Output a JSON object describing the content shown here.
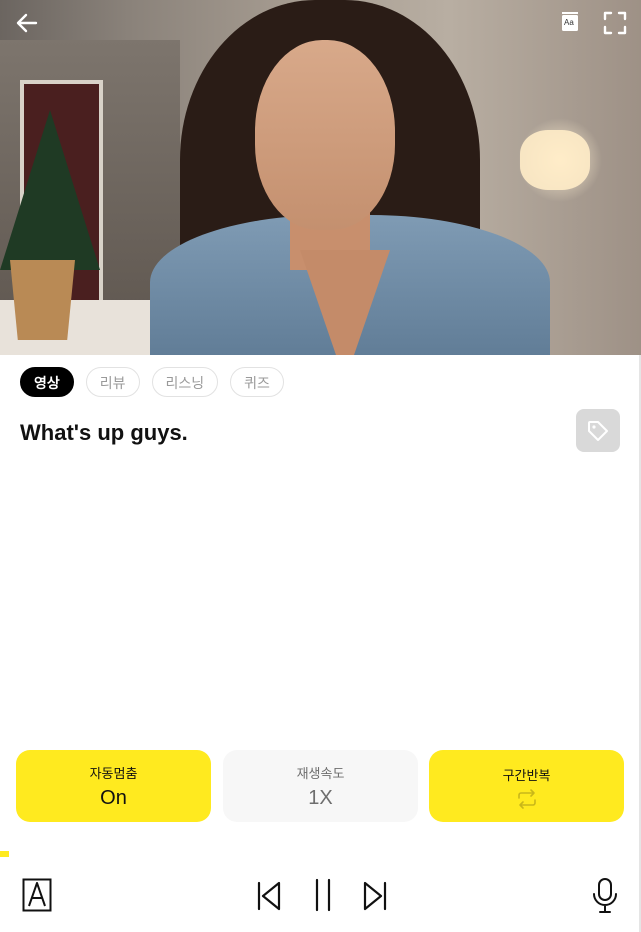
{
  "video": {
    "back_icon": "arrow-left-icon",
    "subtitle_icon": "subtitle-book-icon",
    "subtitle_icon_text": "Aa",
    "fullscreen_icon": "fullscreen-icon"
  },
  "tabs": [
    {
      "label": "영상",
      "active": true
    },
    {
      "label": "리뷰",
      "active": false
    },
    {
      "label": "리스닝",
      "active": false
    },
    {
      "label": "퀴즈",
      "active": false
    }
  ],
  "sentence": "What's up guys.",
  "tag_icon": "tag-icon",
  "controls": {
    "autostop": {
      "label": "자동멈춤",
      "value": "On"
    },
    "speed": {
      "label": "재생속도",
      "value": "1X"
    },
    "repeat": {
      "label": "구간반복",
      "icon": "repeat-icon"
    }
  },
  "colors": {
    "accent": "#ffea1f",
    "active_tab": "#000000",
    "inactive_control": "#f7f7f7"
  },
  "playback": {
    "progress": 0.014
  },
  "bottom_bar": {
    "icons": [
      "font-a-icon",
      "skip-previous-icon",
      "pause-icon",
      "skip-next-icon",
      "microphone-icon"
    ]
  }
}
